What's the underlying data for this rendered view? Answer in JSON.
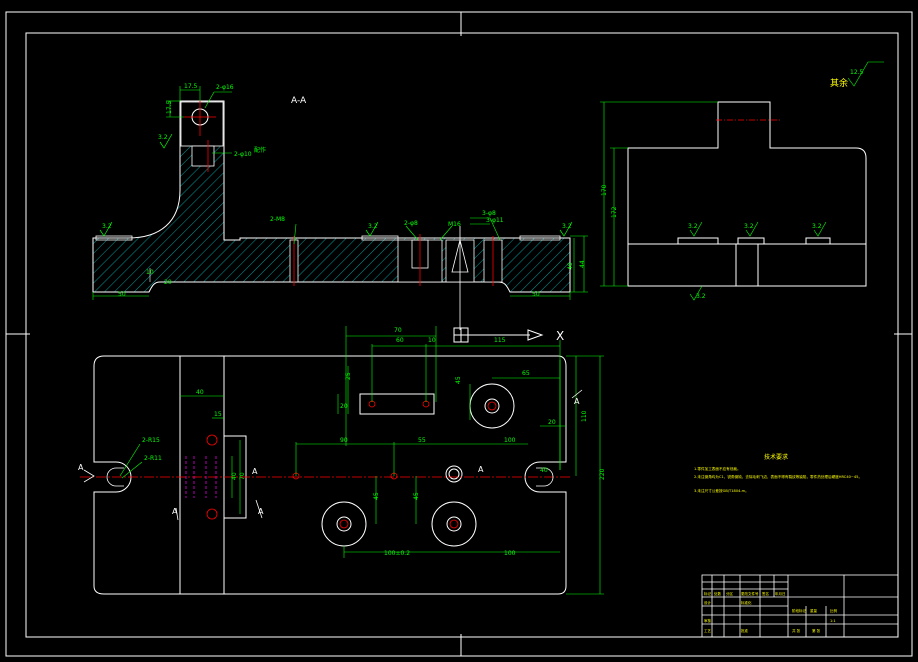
{
  "view_labels": {
    "section_aa": "A-A",
    "roughness_rest": "其余",
    "roughness_rest_value": "12.5",
    "axis_x": "X"
  },
  "annotations": {
    "hole_2x16": "2-φ16",
    "hole_2x10": "2-φ10",
    "hole_2x10_depth": "配作",
    "thread_2m8": "2-M8",
    "hole_2x8": "2-φ8",
    "hole_3x8": "3-φ8",
    "hole_3x11": "3-φ11",
    "thread_m16": "M16",
    "radius_2r15": "2-R15",
    "radius_2r11": "2-R11",
    "section_marker": "A",
    "section_marker_sub": "1"
  },
  "roughness": {
    "r32": "3.2",
    "r63": "6.3"
  },
  "dimensions": {
    "front": [
      "17.5",
      "17.5",
      "50",
      "50",
      "40",
      "44",
      "10",
      "20"
    ],
    "side": [
      "170",
      "172"
    ],
    "plan": [
      "70",
      "60",
      "10",
      "115",
      "65",
      "45",
      "25",
      "40",
      "90",
      "55",
      "100",
      "100±0.2",
      "100",
      "20",
      "110",
      "220",
      "45",
      "45",
      "15",
      "70",
      "40",
      "40",
      "20"
    ]
  },
  "notes": {
    "heading": "技术要求",
    "line1": "1.零件加工表面不应有划痕。",
    "line2": "2.未注倒角均为C1，锐角倒钝，去除毛刺飞边，表面不得有裂纹等缺陷，零件热处理后硬度HRC40~45。",
    "line3": "3.未注尺寸公差按GB/T1804-m。"
  },
  "title_block": {
    "cells": [
      "标记",
      "处数",
      "分区",
      "更改文件号",
      "签名",
      "年月日",
      "设计",
      "标准化",
      "阶段标记",
      "重量",
      "比例",
      "审核",
      "工艺",
      "批准",
      "共 张",
      "第 张",
      "1:1"
    ]
  },
  "colors": {
    "outline": "#ffffff",
    "dimension": "#00ff00",
    "centerline": "#ff0000",
    "hatch": "#00ffff",
    "hidden": "#ff00ff",
    "text": "#ffff00"
  }
}
